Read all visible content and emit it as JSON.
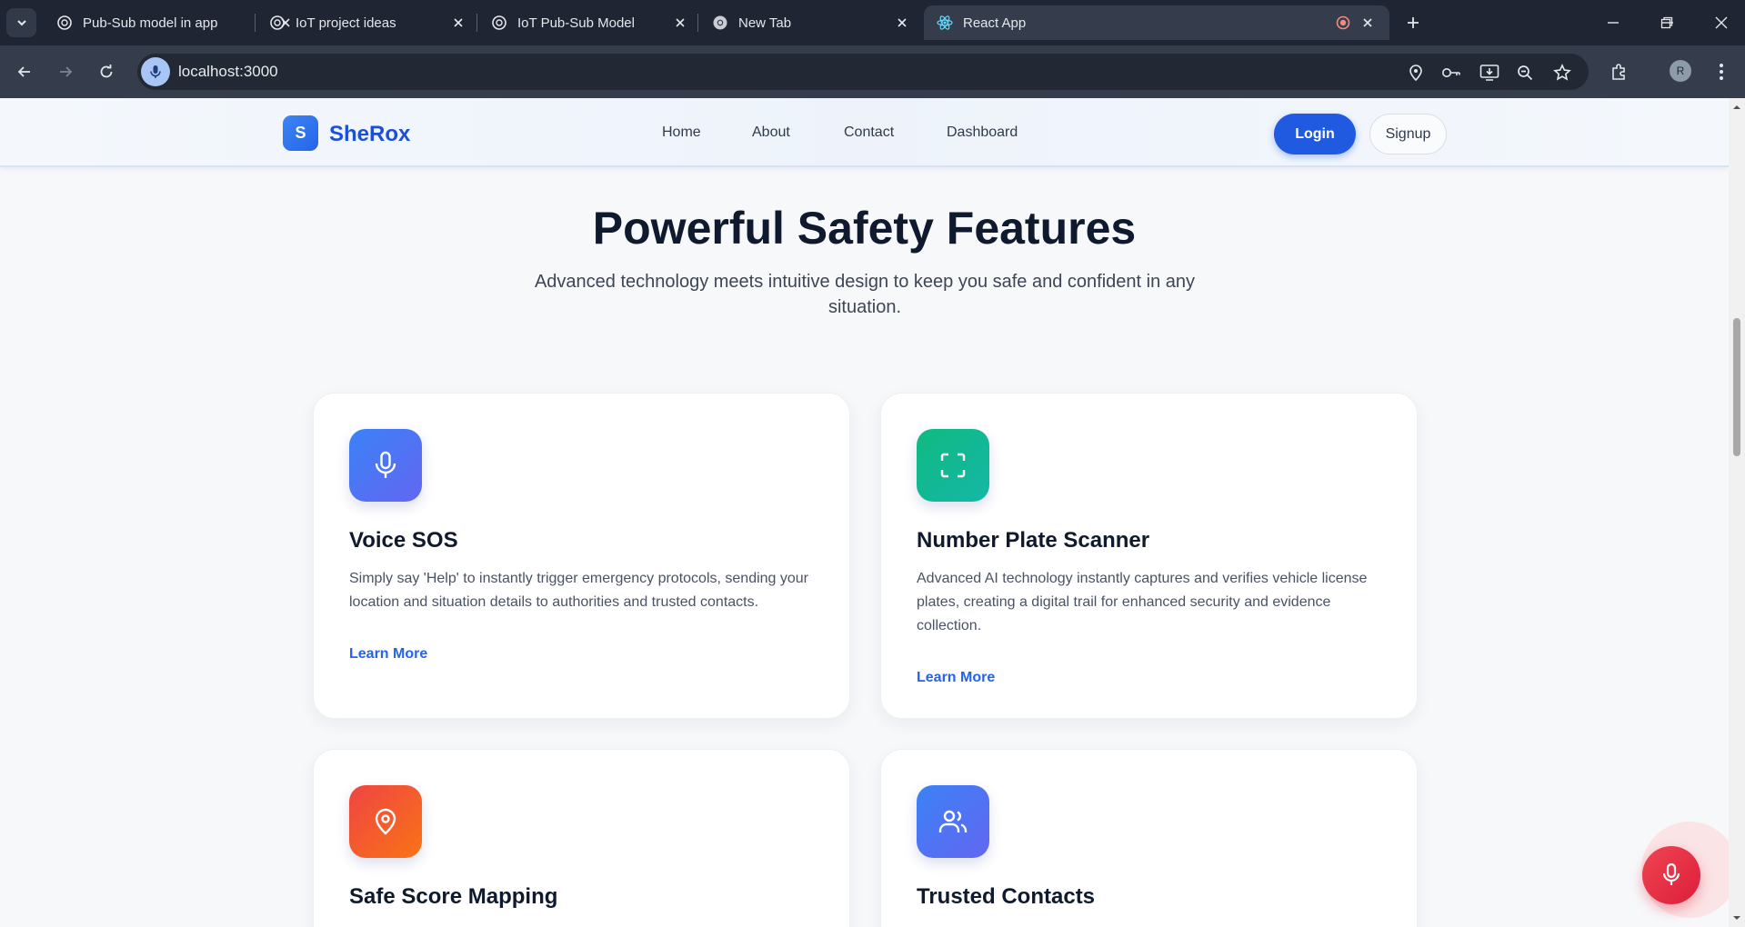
{
  "browser": {
    "tabs": [
      {
        "title": "Pub-Sub model in app",
        "icon": "chatgpt-icon"
      },
      {
        "title": "IoT project ideas",
        "icon": "chatgpt-icon"
      },
      {
        "title": "IoT Pub-Sub Model",
        "icon": "chatgpt-icon"
      },
      {
        "title": "New Tab",
        "icon": "chrome-icon"
      },
      {
        "title": "React App",
        "icon": "react-icon",
        "active": true
      }
    ],
    "url": "localhost:3000",
    "profile_initial": "R"
  },
  "site": {
    "brand_initial": "S",
    "brand_name": "SheRox",
    "nav": [
      "Home",
      "About",
      "Contact",
      "Dashboard"
    ],
    "login_label": "Login",
    "signup_label": "Signup"
  },
  "features": {
    "title": "Powerful Safety Features",
    "subtitle_line1": "Advanced technology meets intuitive design to keep you safe and confident in any",
    "subtitle_line2": "situation.",
    "cards": [
      {
        "title": "Voice SOS",
        "desc": "Simply say 'Help' to instantly trigger emergency protocols, sending your location and situation details to authorities and trusted contacts.",
        "link": "Learn More",
        "icon": "microphone-icon",
        "color_from": "#3b82f6",
        "color_to": "#6366f1"
      },
      {
        "title": "Number Plate Scanner",
        "desc": "Advanced AI technology instantly captures and verifies vehicle license plates, creating a digital trail for enhanced security and evidence collection.",
        "link": "Learn More",
        "icon": "scan-icon",
        "color_from": "#10b981",
        "color_to": "#14b8a6"
      },
      {
        "title": "Safe Score Mapping",
        "icon": "map-pin-icon",
        "color_from": "#ef4444",
        "color_to": "#f97316"
      },
      {
        "title": "Trusted Contacts",
        "icon": "users-icon",
        "color_from": "#3b82f6",
        "color_to": "#6366f1"
      }
    ]
  },
  "fab": {
    "icon": "microphone-icon",
    "color": "#e8283f"
  }
}
